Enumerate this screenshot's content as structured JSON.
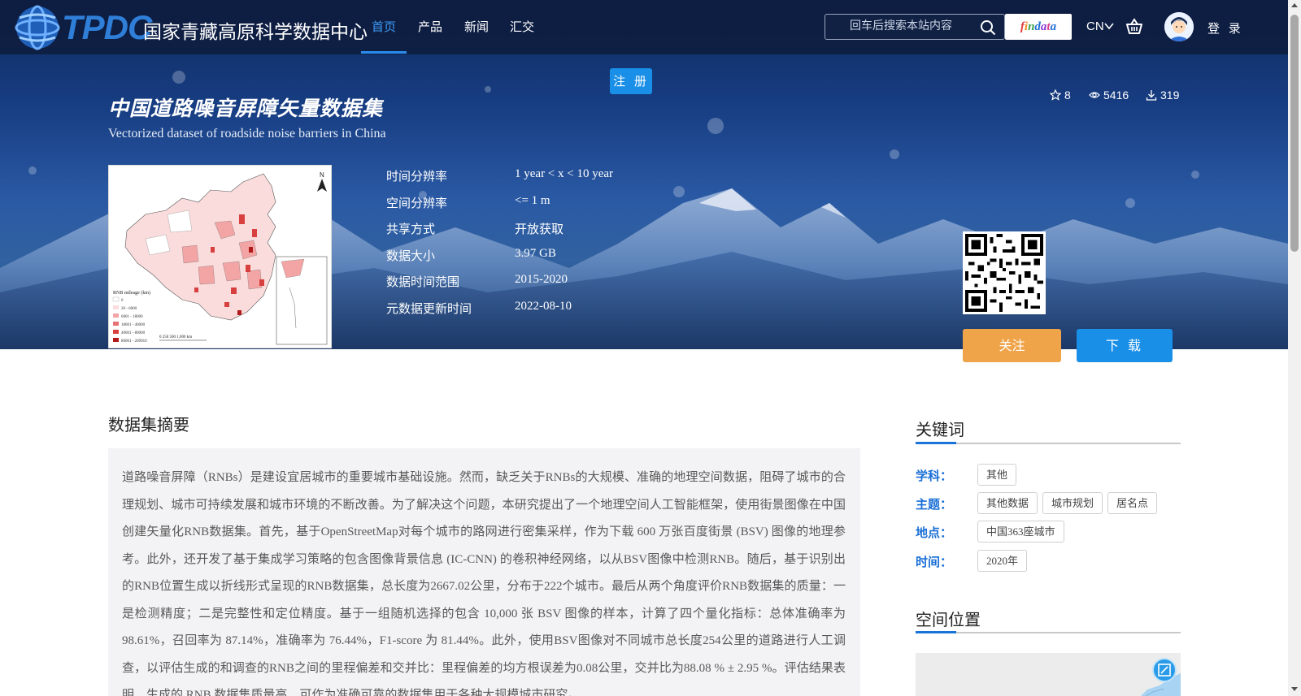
{
  "logo": {
    "abbr": "TPDC",
    "name": "国家青藏高原科学数据中心"
  },
  "nav": [
    {
      "label": "首页",
      "active": true
    },
    {
      "label": "产品",
      "active": false
    },
    {
      "label": "新闻",
      "active": false
    },
    {
      "label": "汇交",
      "active": false
    }
  ],
  "search": {
    "placeholder": "回车后搜索本站内容",
    "value": ""
  },
  "findata_logo": [
    "f",
    "i",
    "n",
    "d",
    "a",
    "t",
    "a"
  ],
  "lang": "CN",
  "login_label": "登 录",
  "register_label": "注 册",
  "dataset": {
    "title_cn": "中国道路噪音屏障矢量数据集",
    "title_en": "Vectorized dataset of roadside noise barriers in China",
    "stats": {
      "stars": "8",
      "views": "5416",
      "downloads": "319"
    }
  },
  "meta": [
    {
      "label": "时间分辨率",
      "value": "1 year < x < 10 year"
    },
    {
      "label": "空间分辨率",
      "value": "<= 1 m"
    },
    {
      "label": "共享方式",
      "value": "开放获取"
    },
    {
      "label": "数据大小",
      "value": "3.97 GB"
    },
    {
      "label": "数据时间范围",
      "value": "2015-2020"
    },
    {
      "label": "元数据更新时间",
      "value": "2022-08-10"
    }
  ],
  "actions": {
    "follow": "关注",
    "download": "下 载"
  },
  "thumbnail": {
    "legend_title": "RNB mileage (km)",
    "legend_items": [
      "0",
      "20 - 6000",
      "6001 - 18000",
      "18001 - 40000",
      "40001 - 80000",
      "80001 - 269910"
    ],
    "scale_label": "0   250  500        1,000 km",
    "north": "N"
  },
  "abstract": {
    "heading": "数据集摘要",
    "text": "道路噪音屏障（RNBs）是建设宜居城市的重要城市基础设施。然而，缺乏关于RNBs的大规模、准确的地理空间数据，阻碍了城市的合理规划、城市可持续发展和城市环境的不断改善。为了解决这个问题，本研究提出了一个地理空间人工智能框架，使用街景图像在中国创建矢量化RNB数据集。首先，基于OpenStreetMap对每个城市的路网进行密集采样，作为下载 600 万张百度街景 (BSV) 图像的地理参考。此外，还开发了基于集成学习策略的包含图像背景信息 (IC-CNN) 的卷积神经网络，以从BSV图像中检测RNB。随后，基于识别出的RNB位置生成以折线形式呈现的RNB数据集，总长度为2667.02公里，分布于222个城市。最后从两个角度评价RNB数据集的质量：一是检测精度；二是完整性和定位精度。基于一组随机选择的包含 10,000 张 BSV 图像的样本，计算了四个量化指标：总体准确率为 98.61%，召回率为 87.14%，准确率为 76.44%，F1-score 为 81.44%。此外，使用BSV图像对不同城市总长度254公里的道路进行人工调查，以评估生成的和调查的RNB之间的里程偏差和交并比：里程偏差的均方根误差为0.08公里，交并比为88.08 % ± 2.95 %。评估结果表明，生成的 RNB 数据集质量高，可作为准确可靠的数据集用于各种大规模城市研究。"
  },
  "keywords": {
    "heading": "关键词",
    "rows": [
      {
        "label": "学科：",
        "tags": [
          "其他"
        ]
      },
      {
        "label": "主题：",
        "tags": [
          "其他数据",
          "城市规划",
          "居名点"
        ]
      },
      {
        "label": "地点：",
        "tags": [
          "中国363座城市"
        ]
      },
      {
        "label": "时间：",
        "tags": [
          "2020年"
        ]
      }
    ]
  },
  "spatial": {
    "heading": "空间位置"
  },
  "colors": {
    "accent": "#1a8fe8",
    "follow": "#f0a44a",
    "nav_active": "#3d9cf5",
    "keyword_label": "#1a6fd6"
  }
}
